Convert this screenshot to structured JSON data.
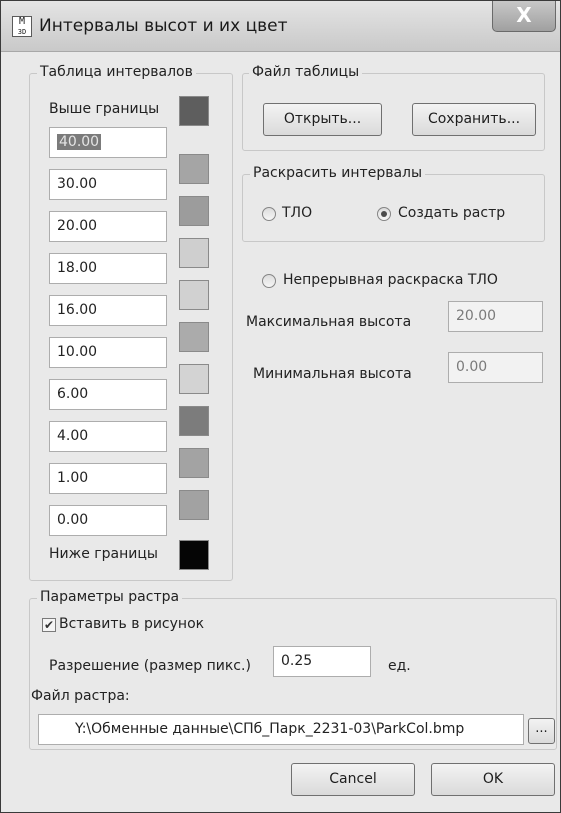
{
  "window": {
    "title": "Интервалы высот и их цвет",
    "icon_text": "M",
    "icon_sub": "3D",
    "close_glyph": "X"
  },
  "intervals": {
    "legend": "Таблица интервалов",
    "above_label": "Выше границы",
    "above_color": "#5e5e5e",
    "values": [
      "40.00",
      "30.00",
      "20.00",
      "18.00",
      "16.00",
      "10.00",
      "6.00",
      "4.00",
      "1.00",
      "0.00"
    ],
    "swatch_colors": [
      "#a5a5a5",
      "#9c9c9c",
      "#cfcfcf",
      "#d1d1d1",
      "#ababab",
      "#d3d3d3",
      "#7c7c7c",
      "#a3a3a3",
      "#a2a2a2"
    ],
    "below_label": "Ниже границы",
    "below_color": "#050505"
  },
  "table_file": {
    "legend": "Файл таблицы",
    "open_label": "Открыть...",
    "save_label": "Сохранить..."
  },
  "colorize": {
    "legend": "Раскрасить интервалы",
    "option_tlo": "ТЛО",
    "option_raster": "Создать растр",
    "selected": "Создать растр"
  },
  "continuous": {
    "label": "Непрерывная раскраска ТЛО",
    "max_label": "Максимальная высота",
    "max_value": "20.00",
    "min_label": "Минимальная высота",
    "min_value": "0.00"
  },
  "raster": {
    "legend": "Параметры растра",
    "insert_label": "Вставить в рисунок",
    "insert_checked": true,
    "resolution_label": "Разрешение (размер пикс.)",
    "resolution_value": "0.25",
    "unit_label": "ед.",
    "file_label": "Файл растра:",
    "file_path": "Y:\\Обменные данные\\СПб_Парк_2231-03\\ParkCol.bmp",
    "browse_label": "..."
  },
  "footer": {
    "cancel_label": "Cancel",
    "ok_label": "OK"
  }
}
